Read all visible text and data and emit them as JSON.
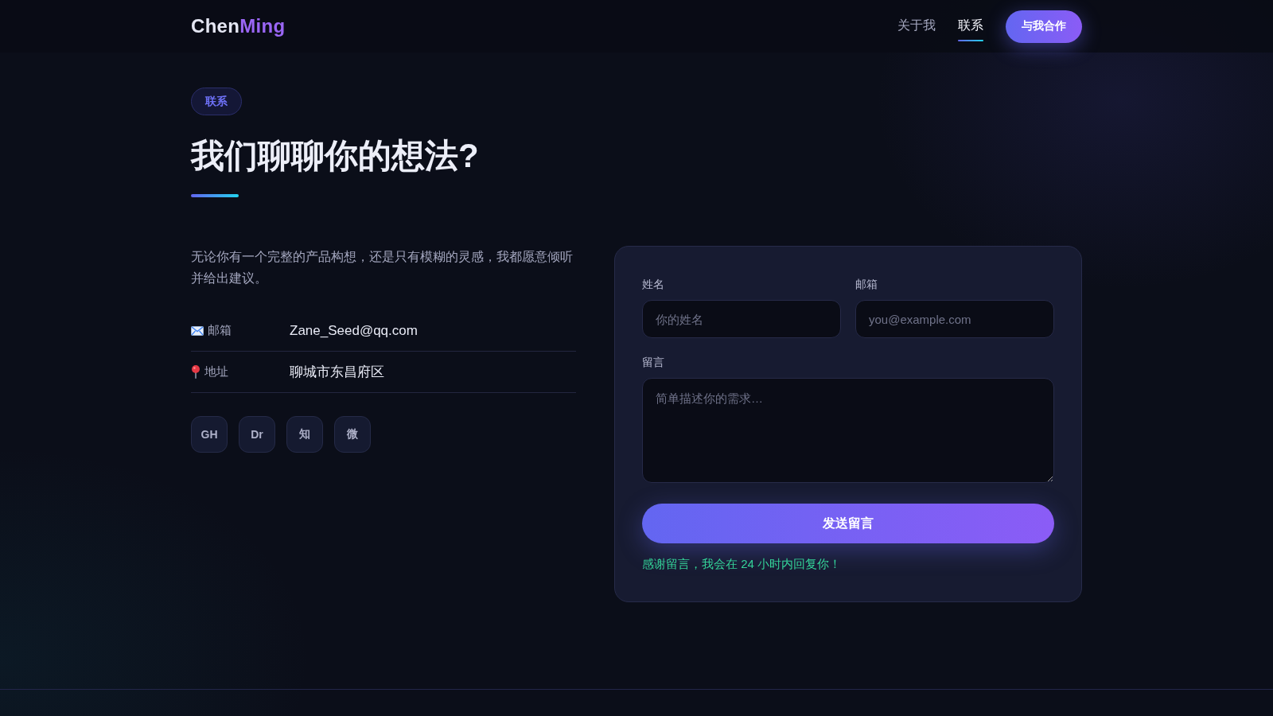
{
  "header": {
    "logo": {
      "primary": "Chen",
      "accent": "Ming"
    },
    "nav": [
      {
        "label": "关于我",
        "selected": false
      },
      {
        "label": "联系",
        "selected": true
      }
    ],
    "cta": "与我合作"
  },
  "hero": {
    "badge": "联系",
    "title": "我们聊聊你的想法?",
    "intro": "无论你有一个完整的产品构想，还是只有模糊的灵感，我都愿意倾听并给出建议。"
  },
  "contacts": [
    {
      "kind": "email",
      "label": "邮箱",
      "value": "Zane_Seed@qq.com"
    },
    {
      "kind": "location",
      "label": "地址",
      "value": "聊城市东昌府区"
    }
  ],
  "socials": [
    "GH",
    "Dr",
    "知",
    "微"
  ],
  "form": {
    "fields": [
      {
        "label": "姓名",
        "placeholder": "你的姓名"
      },
      {
        "label": "邮箱",
        "placeholder": "you@example.com"
      }
    ],
    "message": {
      "label": "留言",
      "placeholder": "简单描述你的需求…"
    },
    "submit": "发送留言",
    "notice": "感谢留言，我会在 24 小时内回复你！"
  }
}
